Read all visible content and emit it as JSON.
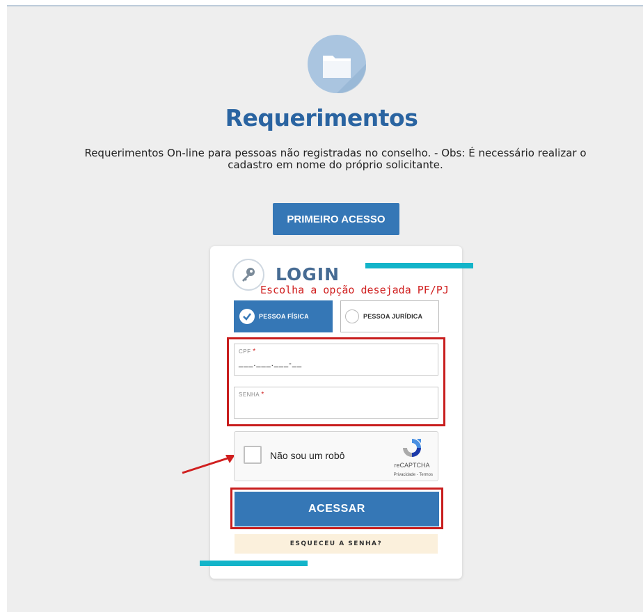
{
  "header": {
    "title": "Requerimentos",
    "description": "Requerimentos On-line para pessoas não registradas no conselho. - Obs: É necessário realizar o cadastro em nome do próprio solicitante.",
    "primeiro_acesso_label": "PRIMEIRO ACESSO",
    "icon": "folder-icon"
  },
  "login": {
    "title": "LOGIN",
    "icon": "key-icon",
    "annotation": "Escolha a opção desejada PF/PJ",
    "person_types": [
      {
        "label": "PESSOA FÍSICA",
        "selected": true
      },
      {
        "label": "PESSOA JURÍDICA",
        "selected": false
      }
    ],
    "cpf": {
      "label": "CPF",
      "required_mark": "*",
      "value": "___.___.___-__"
    },
    "senha": {
      "label": "SENHA",
      "required_mark": "*",
      "value": ""
    },
    "captcha": {
      "text": "Não sou um robô",
      "brand": "reCAPTCHA",
      "links": "Privacidade - Termos"
    },
    "submit_label": "ACESSAR",
    "forgot_label": "ESQUECEU A SENHA?"
  },
  "colors": {
    "primary": "#3577b6",
    "title": "#2a64a1",
    "annotation_red": "#c81e1e",
    "cyan_accent": "#13b4c9",
    "forgot_bg": "#fbf0dc"
  }
}
